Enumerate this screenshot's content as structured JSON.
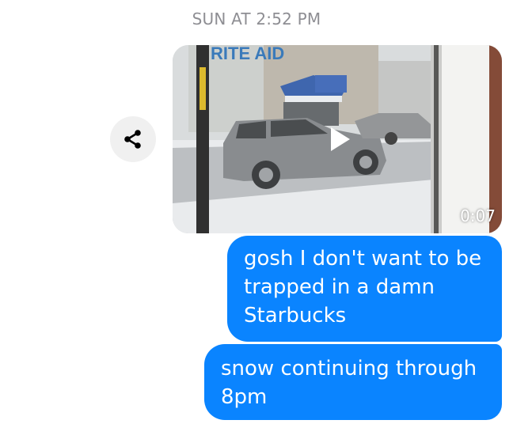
{
  "thread": {
    "timestamp": "SUN AT 2:52 PM"
  },
  "video_message": {
    "duration": "0:07",
    "sign_text": "RITE AID",
    "play_icon": "play-icon",
    "share_icon": "share-icon"
  },
  "messages": [
    {
      "text": "gosh I don't want to be trapped in a damn Starbucks"
    },
    {
      "text": "snow continuing through 8pm"
    }
  ],
  "colors": {
    "bubble_background": "#0a84ff",
    "bubble_text": "#ffffff",
    "timestamp_text": "#8e8e93",
    "share_button_bg": "#f0f0f0"
  }
}
